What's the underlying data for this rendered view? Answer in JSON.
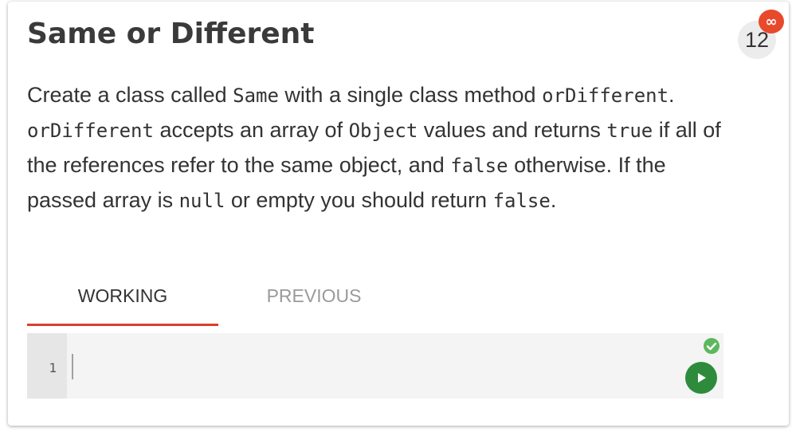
{
  "problem": {
    "title": "Same or Different",
    "counter": "12",
    "badge": "∞",
    "description": [
      {
        "t": "text",
        "v": "Create a class called "
      },
      {
        "t": "code",
        "v": "Same"
      },
      {
        "t": "text",
        "v": " with a single class method "
      },
      {
        "t": "code",
        "v": "orDifferent"
      },
      {
        "t": "text",
        "v": ". "
      },
      {
        "t": "code",
        "v": "orDifferent"
      },
      {
        "t": "text",
        "v": " accepts an array of "
      },
      {
        "t": "code",
        "v": "Object"
      },
      {
        "t": "text",
        "v": " values and returns "
      },
      {
        "t": "code",
        "v": "true"
      },
      {
        "t": "text",
        "v": " if all of the references refer to the same object, and "
      },
      {
        "t": "code",
        "v": "false"
      },
      {
        "t": "text",
        "v": " otherwise. If the passed array is "
      },
      {
        "t": "code",
        "v": "null"
      },
      {
        "t": "text",
        "v": " or empty you should return "
      },
      {
        "t": "code",
        "v": "false"
      },
      {
        "t": "text",
        "v": "."
      }
    ]
  },
  "tabs": {
    "working": "WORKING",
    "previous": "PREVIOUS",
    "active": "working"
  },
  "editor": {
    "line_numbers": [
      "1"
    ],
    "code": "",
    "status_icon": "check-circle-icon",
    "run_icon": "play-icon"
  },
  "colors": {
    "accent": "#d7402b",
    "badge": "#e8492b",
    "success": "#5cb85c",
    "run": "#2e8b3c"
  }
}
